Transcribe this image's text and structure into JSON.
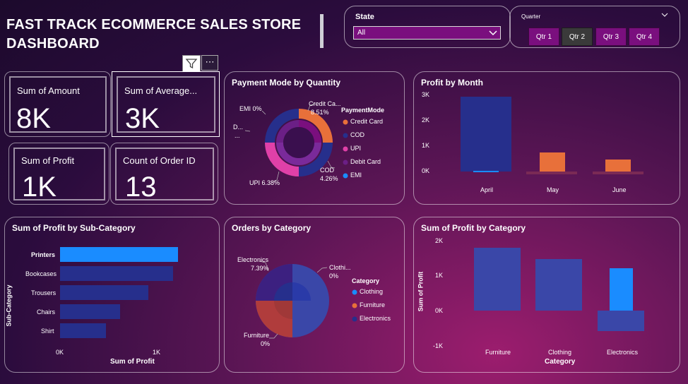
{
  "header": {
    "title_line1": "FAST TRACK ECOMMERCE SALES STORE",
    "title_line2": "DASHBOARD"
  },
  "state_slicer": {
    "label": "State",
    "selected": "All"
  },
  "quarter_slicer": {
    "label": "Quarter",
    "buttons": [
      {
        "label": "Qtr 1",
        "color": "#7a0f7e"
      },
      {
        "label": "Qtr 2",
        "color": "#3a3a3a"
      },
      {
        "label": "Qtr 3",
        "color": "#7a0f7e"
      },
      {
        "label": "Qtr 4",
        "color": "#7a0f7e"
      }
    ]
  },
  "toolbar": {
    "filter_icon": "filter-icon",
    "more_icon": "more-options-icon",
    "more_label": "⋯"
  },
  "kpis": {
    "amount": {
      "label": "Sum of Amount",
      "value": "8K"
    },
    "average": {
      "label": "Sum of Average...",
      "value": "3K"
    },
    "profit": {
      "label": "Sum of Profit",
      "value": "1K"
    },
    "orders": {
      "label": "Count of Order ID",
      "value": "13"
    }
  },
  "payment": {
    "title": "Payment Mode by Quantity",
    "legend_title": "PaymentMode",
    "labels": {
      "credit": "Credit Ca...",
      "credit_pct": "8.51%",
      "cod": "COD",
      "cod_pct": "4.26%",
      "upi": "UPI 6.38%",
      "emi": "EMI 0%",
      "debit": "D...",
      "debit_dots": "..."
    }
  },
  "profit_month": {
    "title": "Profit by Month",
    "y_ticks": [
      "3K",
      "2K",
      "1K",
      "0K"
    ]
  },
  "subcat": {
    "title": "Sum of Profit by Sub-Category",
    "ylabel": "Sub-Category",
    "xlabel": "Sum of Profit",
    "x_ticks": [
      "0K",
      "1K"
    ]
  },
  "orders_cat": {
    "title": "Orders by Category",
    "legend_title": "Category",
    "labels": {
      "electronics": "Electronics",
      "electronics_pct": "7.39%",
      "clothing": "Clothi...",
      "clothing_pct": "0%",
      "furniture": "Furniture",
      "furniture_pct": "0%"
    }
  },
  "profit_cat": {
    "title": "Sum of Profit by Category",
    "ylabel": "Sum of Profit",
    "xlabel": "Category",
    "y_ticks": [
      "2K",
      "1K",
      "0K",
      "-1K"
    ]
  },
  "chart_data": [
    {
      "type": "pie",
      "title": "Payment Mode by Quantity",
      "categories": [
        "Credit Card",
        "COD",
        "UPI",
        "Debit Card",
        "EMI"
      ],
      "values": [
        8.51,
        4.26,
        6.38,
        0,
        0
      ],
      "colors": [
        "#e8703a",
        "#262f8c",
        "#e040a8",
        "#6b1f86",
        "#1a8cff"
      ]
    },
    {
      "type": "bar",
      "title": "Profit by Month",
      "categories": [
        "April",
        "May",
        "June"
      ],
      "values": [
        3000,
        800,
        500
      ],
      "ylim": [
        0,
        3000
      ]
    },
    {
      "type": "bar",
      "title": "Sum of Profit by Sub-Category",
      "categories": [
        "Printers",
        "Bookcases",
        "Trousers",
        "Chairs",
        "Shirt"
      ],
      "values": [
        1200,
        1150,
        900,
        600,
        470
      ],
      "xlabel": "Sum of Profit",
      "ylabel": "Sub-Category",
      "xlim": [
        0,
        1000
      ]
    },
    {
      "type": "pie",
      "title": "Orders by Category",
      "categories": [
        "Clothing",
        "Furniture",
        "Electronics"
      ],
      "values": [
        0,
        0,
        7.39
      ],
      "colors": [
        "#1a8cff",
        "#e8703a",
        "#262f8c"
      ]
    },
    {
      "type": "bar",
      "title": "Sum of Profit by Category",
      "categories": [
        "Furniture",
        "Clothing",
        "Electronics"
      ],
      "values": [
        1800,
        1500,
        1200
      ],
      "xlabel": "Category",
      "ylabel": "Sum of Profit",
      "ylim": [
        -1000,
        2000
      ]
    }
  ]
}
